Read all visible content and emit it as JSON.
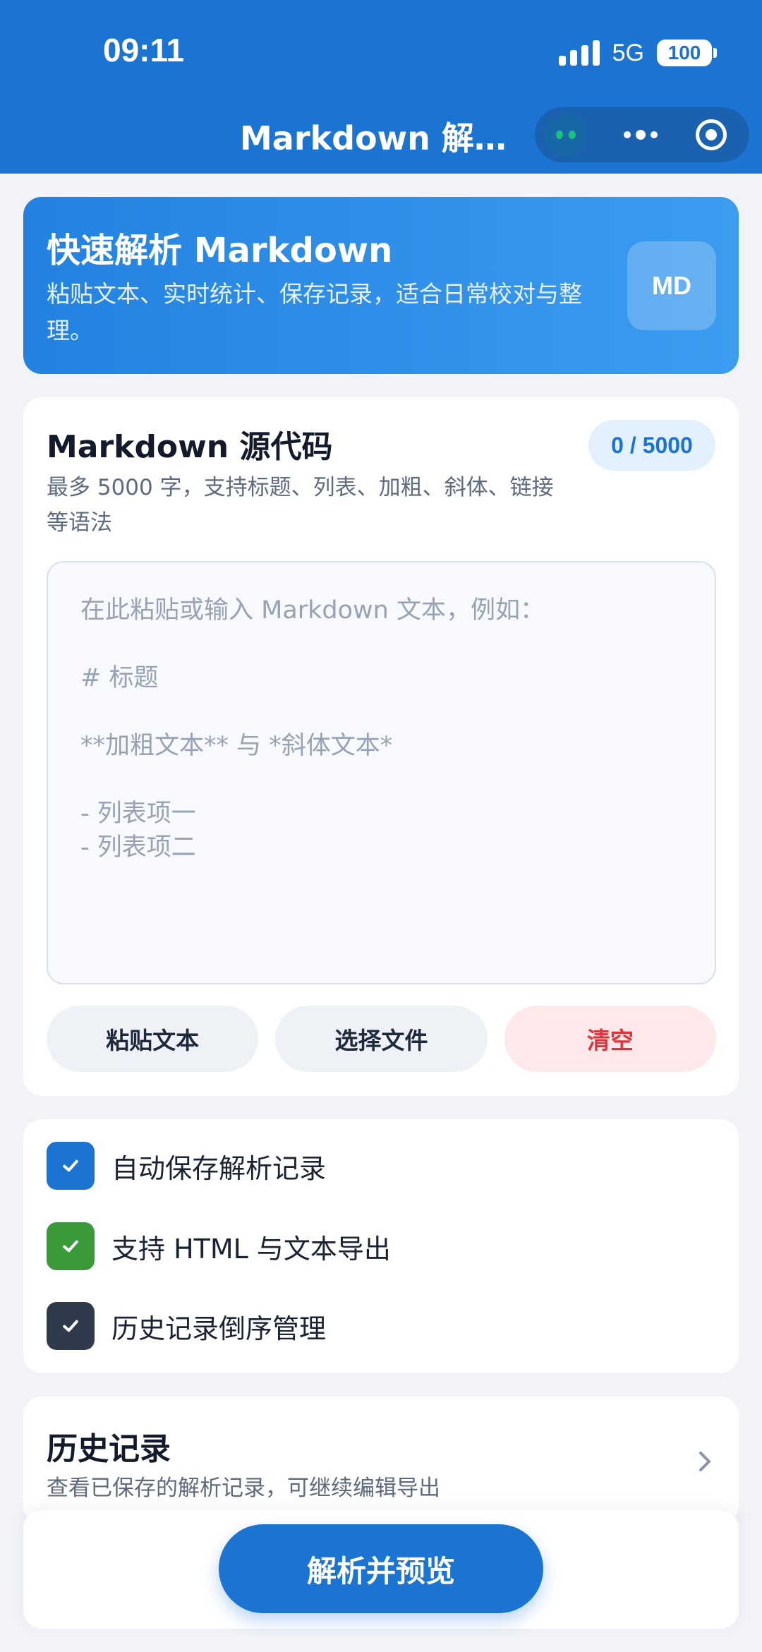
{
  "status_bar": {
    "time": "09:11",
    "network": "5G",
    "battery": "100"
  },
  "nav": {
    "title": "Markdown 解析..."
  },
  "hero": {
    "title": "快速解析 Markdown",
    "description": "粘贴文本、实时统计、保存记录，适合日常校对与整理。",
    "badge": "MD"
  },
  "editor": {
    "title": "Markdown 源代码",
    "char_count": "0 / 5000",
    "description": "最多 5000 字，支持标题、列表、加粗、斜体、链接等语法",
    "value": "",
    "placeholder": "在此粘贴或输入 Markdown 文本，例如：\n\n# 标题\n\n**加粗文本** 与 *斜体文本*\n\n- 列表项一\n- 列表项二",
    "paste_label": "粘贴文本",
    "file_label": "选择文件",
    "clear_label": "清空"
  },
  "options": [
    {
      "label": "自动保存解析记录",
      "checked": true,
      "color": "#1c74d2"
    },
    {
      "label": "支持 HTML 与文本导出",
      "checked": true,
      "color": "#3a9a3a"
    },
    {
      "label": "历史记录倒序管理",
      "checked": true,
      "color": "#2f3a4b"
    }
  ],
  "history": {
    "title": "历史记录",
    "description": "查看已保存的解析记录，可继续编辑导出"
  },
  "action": {
    "primary_label": "解析并预览"
  },
  "colors": {
    "primary": "#1c74d2",
    "danger": "#e0343b",
    "success": "#3a9a3a"
  }
}
